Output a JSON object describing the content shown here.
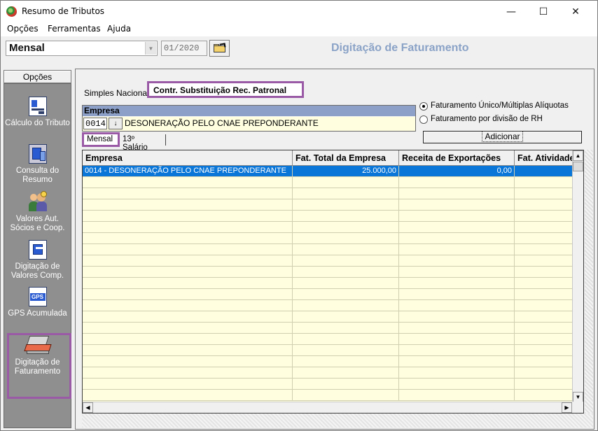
{
  "window": {
    "title": "Resumo de Tributos",
    "minimize": "—",
    "maximize": "☐",
    "close": "✕"
  },
  "menu": [
    "Opções",
    "Ferramentas",
    "Ajuda"
  ],
  "toolbar": {
    "period": "Mensal",
    "date": "01/2020",
    "heading": "Digitação de Faturamento"
  },
  "sidebar": {
    "header": "Opções",
    "items": [
      {
        "label": "Cálculo do Tributo",
        "icon": "calc-document-icon"
      },
      {
        "label": "Consulta do Resumo",
        "icon": "consult-summary-icon"
      },
      {
        "label": "Valores Aut. Sócios e Coop.",
        "icon": "partners-icon"
      },
      {
        "label": "Digitação de Valores Comp.",
        "icon": "complementary-values-icon"
      },
      {
        "label": "GPS Acumulada",
        "icon": "gps-icon",
        "icon_text": "GPS"
      },
      {
        "label": "Digitação de Faturamento",
        "icon": "billing-laptop-icon",
        "active": true
      }
    ]
  },
  "tabs": {
    "first": "Simples Nacional",
    "second": "Contr. Substituição Rec. Patronal"
  },
  "empresa": {
    "header": "Empresa",
    "code": "0014",
    "name": "DESONERAÇÃO PELO CNAE PREPONDERANTE",
    "dropdown": "↓"
  },
  "options": {
    "radio1": "Faturamento Único/Múltiplas Alíquotas",
    "radio2": "Faturamento por divisão de RH",
    "selected": "radio1",
    "add_button": "Adicionar"
  },
  "subtabs": {
    "monthly": "Mensal",
    "thirteenth": "13º Salário"
  },
  "grid": {
    "columns": [
      "Empresa",
      "Fat. Total da Empresa",
      "Receita de Exportações",
      "Fat. Atividade"
    ],
    "rows": [
      [
        "0014 - DESONERAÇÃO PELO CNAE PREPONDERANTE",
        "25.000,00",
        "0,00",
        ""
      ]
    ]
  }
}
